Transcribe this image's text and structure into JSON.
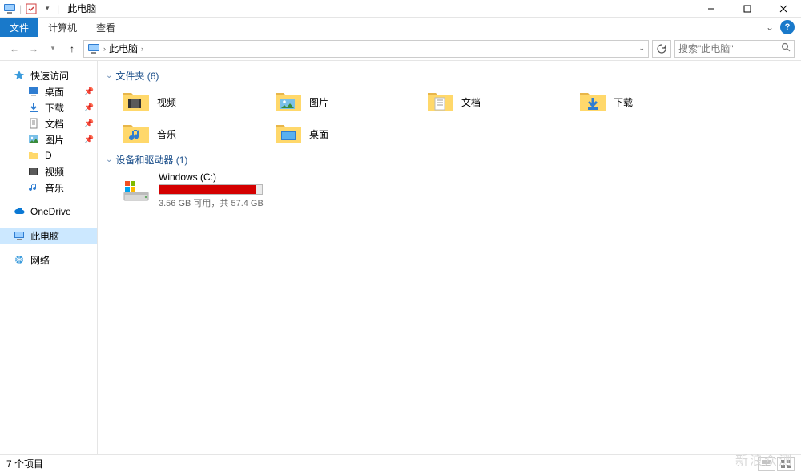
{
  "window": {
    "title": "此电脑",
    "minimize": "—",
    "maximize": "☐",
    "close": "✕"
  },
  "ribbon": {
    "file": "文件",
    "computer": "计算机",
    "view": "查看"
  },
  "address": {
    "location": "此电脑"
  },
  "search": {
    "placeholder": "搜索\"此电脑\""
  },
  "nav": {
    "quick_access": "快速访问",
    "desktop": "桌面",
    "downloads": "下载",
    "documents": "文档",
    "pictures": "图片",
    "d_folder": "D",
    "videos": "视频",
    "music": "音乐",
    "onedrive": "OneDrive",
    "this_pc": "此电脑",
    "network": "网络"
  },
  "groups": {
    "folders": "文件夹 (6)",
    "devices": "设备和驱动器 (1)"
  },
  "folders": {
    "items": [
      {
        "label": "视频"
      },
      {
        "label": "图片"
      },
      {
        "label": "文档"
      },
      {
        "label": "下载"
      },
      {
        "label": "音乐"
      },
      {
        "label": "桌面"
      }
    ]
  },
  "drive": {
    "name": "Windows (C:)",
    "stats": "3.56 GB 可用，共 57.4 GB",
    "fill_percent": 94
  },
  "status": {
    "item_count": "7 个项目"
  },
  "watermark": "新浪众测"
}
